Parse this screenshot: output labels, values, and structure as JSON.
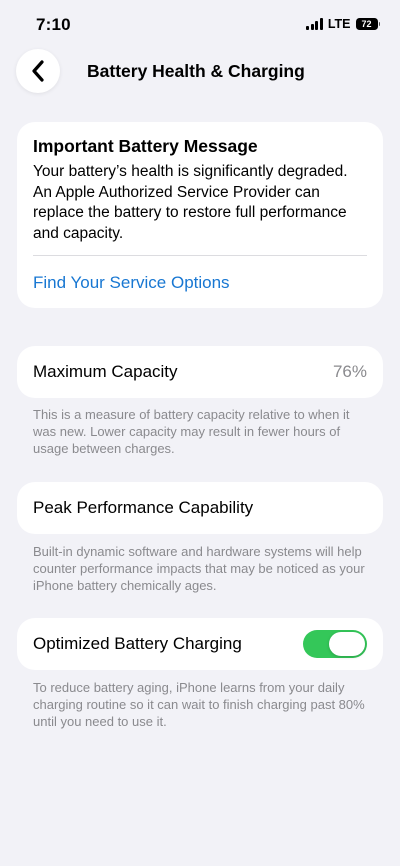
{
  "status_bar": {
    "time": "7:10",
    "network": "LTE",
    "battery_level": "72"
  },
  "nav": {
    "back_icon": "chevron-left-icon",
    "title": "Battery Health & Charging"
  },
  "message": {
    "title": "Important Battery Message",
    "body": "Your battery’s health is significantly degraded. An Apple Authorized Service Provider can replace the battery to restore full performance and capacity.",
    "link": "Find Your Service Options",
    "link_color": "#1877d2"
  },
  "capacity": {
    "label": "Maximum Capacity",
    "value": "76%",
    "note": "This is a measure of battery capacity relative to when it was new. Lower capacity may result in fewer hours of usage between charges."
  },
  "peak": {
    "label": "Peak Performance Capability",
    "note": "Built-in dynamic software and hardware systems will help counter performance impacts that may be noticed as your iPhone battery chemically ages."
  },
  "charging": {
    "label": "Optimized Battery Charging",
    "enabled": true,
    "toggle_color": "#34c759",
    "note": "To reduce battery aging, iPhone learns from your daily charging routine so it can wait to finish charging past 80% until you need to use it."
  }
}
